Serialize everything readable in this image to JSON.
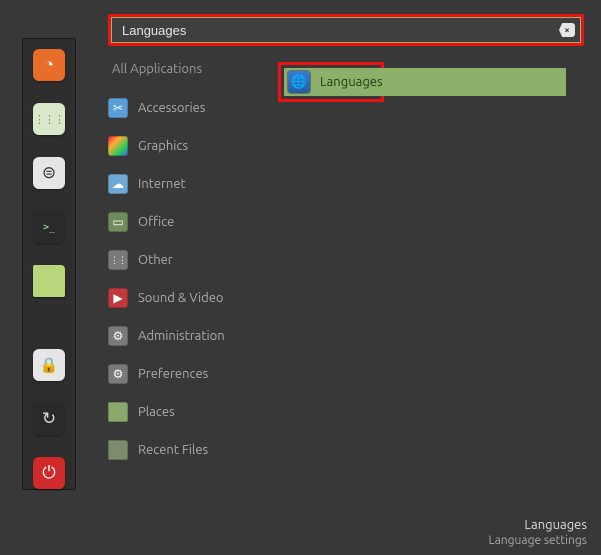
{
  "search": {
    "value": "Languages"
  },
  "categories": {
    "all": "All Applications",
    "items": [
      {
        "label": "Accessories",
        "color": "#5aa0d6",
        "glyph": "✂"
      },
      {
        "label": "Graphics",
        "color": "linear",
        "glyph": ""
      },
      {
        "label": "Internet",
        "color": "#6fa8d6",
        "glyph": "☁"
      },
      {
        "label": "Office",
        "color": "#6f8c5a",
        "glyph": "▭"
      },
      {
        "label": "Other",
        "color": "#7a7a7a",
        "glyph": "⋮⋮"
      },
      {
        "label": "Sound & Video",
        "color": "#c03a3a",
        "glyph": "▶"
      },
      {
        "label": "Administration",
        "color": "#7a7a7a",
        "glyph": "⚙"
      },
      {
        "label": "Preferences",
        "color": "#7a7a7a",
        "glyph": "⚙"
      },
      {
        "label": "Places",
        "color": "#8aa86a",
        "glyph": ""
      },
      {
        "label": "Recent Files",
        "color": "#7d8c6a",
        "glyph": ""
      }
    ]
  },
  "result": {
    "label": "Languages"
  },
  "footer": {
    "title": "Languages",
    "subtitle": "Language settings"
  },
  "taskbar_icons": [
    {
      "name": "firefox-icon",
      "bg": "#e86c2a",
      "glyph": "◔",
      "color": "#fff"
    },
    {
      "name": "apps-icon",
      "bg": "#d8e8c8",
      "glyph": "⋮⋮⋮",
      "color": "#6a9a3a"
    },
    {
      "name": "settings-icon",
      "bg": "#e6e6e6",
      "glyph": "⊜",
      "color": "#555"
    },
    {
      "name": "terminal-icon",
      "bg": "#2a2a2a",
      "glyph": ">_",
      "color": "#b8e8a0"
    },
    {
      "name": "files-icon",
      "bg": "#b8d67a",
      "glyph": "",
      "color": "#fff"
    },
    {
      "name": "lock-icon",
      "bg": "#e6e6e6",
      "glyph": "🔒",
      "color": "#222"
    },
    {
      "name": "refresh-icon",
      "bg": "#2a2a2a",
      "glyph": "↻",
      "color": "#ddd"
    },
    {
      "name": "power-icon",
      "bg": "#d12a2a",
      "glyph": "⏻",
      "color": "#fff"
    }
  ]
}
